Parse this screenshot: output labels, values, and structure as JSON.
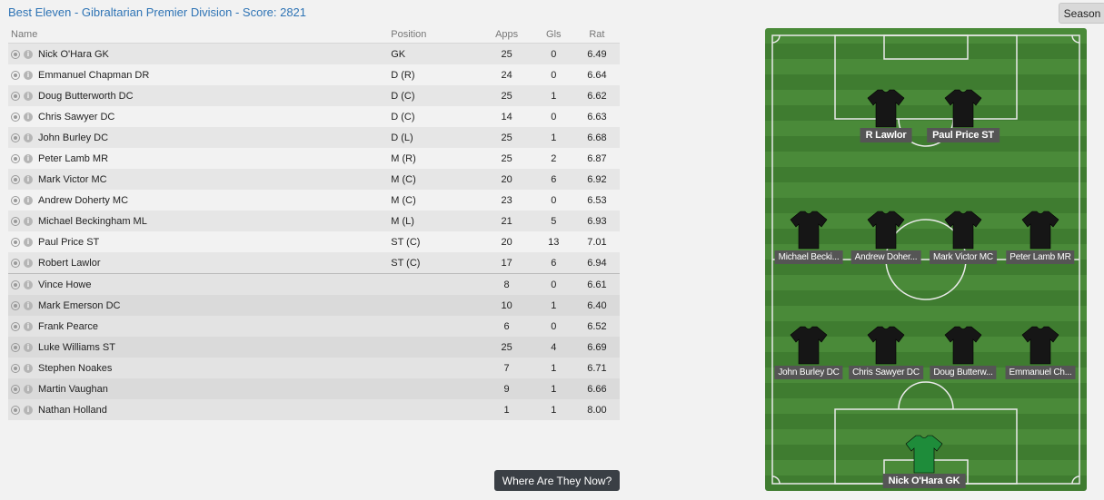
{
  "title": "Best Eleven - Gibraltarian Premier Division - Score: 2821",
  "season_button": "Season",
  "columns": {
    "name": "Name",
    "position": "Position",
    "apps": "Apps",
    "gls": "Gls",
    "rat": "Rat"
  },
  "starters": [
    {
      "name": "Nick O'Hara GK",
      "position": "GK",
      "apps": "25",
      "gls": "0",
      "rat": "6.49"
    },
    {
      "name": "Emmanuel Chapman DR",
      "position": "D (R)",
      "apps": "24",
      "gls": "0",
      "rat": "6.64"
    },
    {
      "name": "Doug Butterworth DC",
      "position": "D (C)",
      "apps": "25",
      "gls": "1",
      "rat": "6.62"
    },
    {
      "name": "Chris Sawyer DC",
      "position": "D (C)",
      "apps": "14",
      "gls": "0",
      "rat": "6.63"
    },
    {
      "name": "John Burley DC",
      "position": "D (L)",
      "apps": "25",
      "gls": "1",
      "rat": "6.68"
    },
    {
      "name": "Peter Lamb MR",
      "position": "M (R)",
      "apps": "25",
      "gls": "2",
      "rat": "6.87"
    },
    {
      "name": "Mark Victor MC",
      "position": "M (C)",
      "apps": "20",
      "gls": "6",
      "rat": "6.92"
    },
    {
      "name": "Andrew Doherty MC",
      "position": "M (C)",
      "apps": "23",
      "gls": "0",
      "rat": "6.53"
    },
    {
      "name": "Michael Beckingham ML",
      "position": "M (L)",
      "apps": "21",
      "gls": "5",
      "rat": "6.93"
    },
    {
      "name": "Paul Price ST",
      "position": "ST (C)",
      "apps": "20",
      "gls": "13",
      "rat": "7.01"
    },
    {
      "name": "Robert Lawlor",
      "position": "ST (C)",
      "apps": "17",
      "gls": "6",
      "rat": "6.94"
    }
  ],
  "subs": [
    {
      "name": "Vince Howe",
      "position": "",
      "apps": "8",
      "gls": "0",
      "rat": "6.61"
    },
    {
      "name": "Mark Emerson DC",
      "position": "",
      "apps": "10",
      "gls": "1",
      "rat": "6.40"
    },
    {
      "name": "Frank Pearce",
      "position": "",
      "apps": "6",
      "gls": "0",
      "rat": "6.52"
    },
    {
      "name": "Luke Williams ST",
      "position": "",
      "apps": "25",
      "gls": "4",
      "rat": "6.69"
    },
    {
      "name": "Stephen Noakes",
      "position": "",
      "apps": "7",
      "gls": "1",
      "rat": "6.71"
    },
    {
      "name": "Martin Vaughan",
      "position": "",
      "apps": "9",
      "gls": "1",
      "rat": "6.66"
    },
    {
      "name": "Nathan Holland",
      "position": "",
      "apps": "1",
      "gls": "1",
      "rat": "8.00"
    }
  ],
  "where_button": "Where Are They Now?",
  "pitch": {
    "outfield_shirt_color": "#161616",
    "gk_shirt_color": "#1e8c3a",
    "forwards": [
      "R Lawlor",
      "Paul Price ST"
    ],
    "midfield": [
      "Michael Becki...",
      "Andrew Doher...",
      "Mark Victor MC",
      "Peter Lamb MR"
    ],
    "defence": [
      "John Burley DC",
      "Chris Sawyer DC",
      "Doug Butterw...",
      "Emmanuel Ch..."
    ],
    "goalkeeper": "Nick O'Hara GK"
  }
}
